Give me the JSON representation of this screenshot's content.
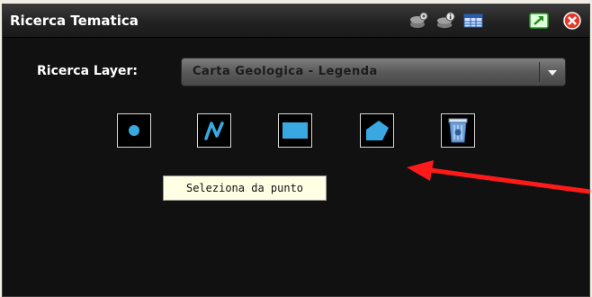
{
  "window": {
    "title": "Ricerca Tematica",
    "toolbar_icons": [
      "layers-settings-icon",
      "layers-info-icon",
      "table-icon",
      "external-link-icon",
      "close-icon"
    ]
  },
  "search": {
    "label": "Ricerca Layer:",
    "layer_value": "Carta Geologica - Legenda"
  },
  "tools": [
    {
      "icon": "point-icon"
    },
    {
      "icon": "line-icon"
    },
    {
      "icon": "rectangle-icon"
    },
    {
      "icon": "polygon-icon"
    },
    {
      "icon": "recycle-bin-icon"
    }
  ],
  "tooltip": {
    "text": "Seleziona da punto"
  },
  "colors": {
    "tool_fill": "#3aa8e0",
    "annotation_arrow": "#ff1a1a"
  }
}
